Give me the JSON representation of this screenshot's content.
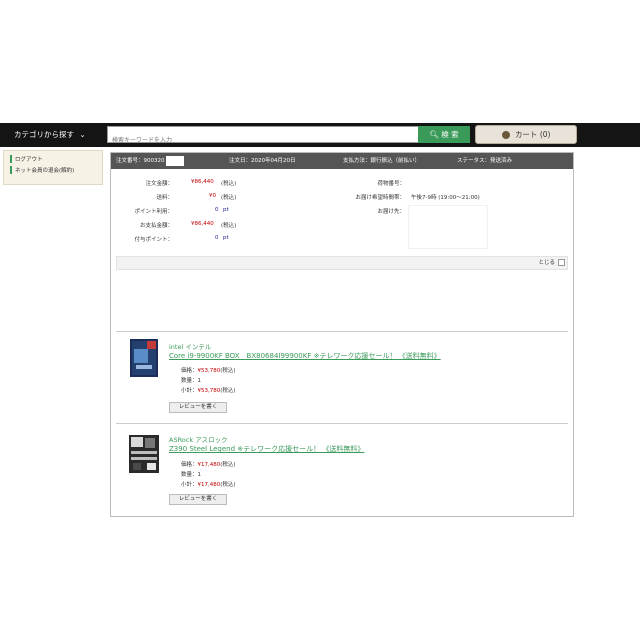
{
  "header": {
    "category_label": "カテゴリから探す",
    "search_placeholder": "検索キーワードを入力",
    "search_button": "検 索",
    "cart_label": "カート (0)"
  },
  "sidebar": {
    "items": [
      {
        "label": "ログアウト"
      },
      {
        "label": "ネット会員の退会(解約)"
      }
    ]
  },
  "order": {
    "number_label": "注文番号：900320",
    "date_label": "注文日：2020年04月20日",
    "payment_label": "支払方法：銀行振込（前払い）",
    "status_label": "ステータス：発送済み",
    "rows": [
      {
        "label": "注文金額：",
        "value": "¥86,440",
        "note": "(税込)"
      },
      {
        "label": "送料：",
        "value": "¥0",
        "note": "(税込)"
      },
      {
        "label": "ポイント利用：",
        "value": "0",
        "note": "pt"
      },
      {
        "label": "お支払金額：",
        "value": "¥86,440",
        "note": "(税込)"
      },
      {
        "label": "付与ポイント：",
        "value": "0",
        "note": "pt"
      }
    ],
    "delivery": [
      {
        "label": "荷物番号：",
        "value": ""
      },
      {
        "label": "お届け希望時間帯：",
        "value": "午後7-9時 (19:00〜21:00)"
      },
      {
        "label": "お届け先：",
        "value": ""
      }
    ],
    "close_label": "とじる",
    "items": [
      {
        "brand": "intel インテル",
        "name": "Core i9-9900KF BOX　BX80684I99900KF ※テレワーク応援セール！ 《送料無料》",
        "price_label": "価格：",
        "price": "¥53,780",
        "price_note": "(税込)",
        "qty_label": "数量：",
        "qty": "1",
        "subtotal_label": "小計：",
        "subtotal": "¥53,780",
        "subtotal_note": "(税込)",
        "review_button": "レビューを書く"
      },
      {
        "brand": "ASRock アスロック",
        "name": "Z390 Steel Legend ※テレワーク応援セール！ 《送料無料》",
        "price_label": "価格：",
        "price": "¥17,480",
        "price_note": "(税込)",
        "qty_label": "数量：",
        "qty": "1",
        "subtotal_label": "小計：",
        "subtotal": "¥17,480",
        "subtotal_note": "(税込)",
        "review_button": "レビューを書く"
      }
    ]
  }
}
